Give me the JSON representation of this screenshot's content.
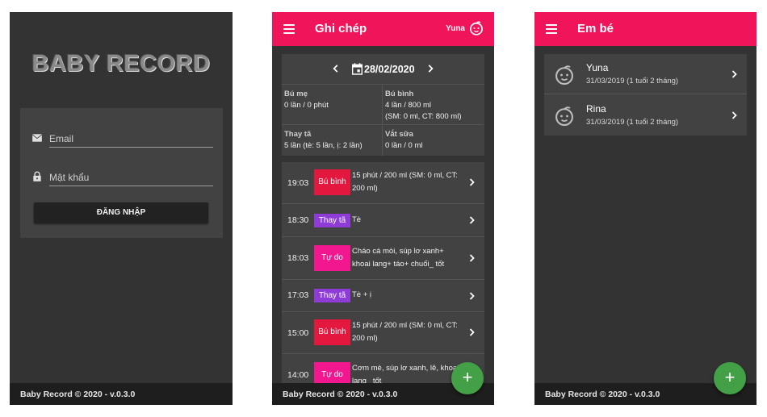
{
  "colors": {
    "accent": "#f0145a",
    "background": "#333333",
    "card": "#424242",
    "fab": "#43a047",
    "badge_feed": "#e4173f",
    "badge_diaper": "#8e3bd8",
    "badge_free": "#f2168f"
  },
  "login": {
    "logo": "BABY RECORD",
    "email_placeholder": "Email",
    "password_placeholder": "Mật khẩu",
    "login_button": "ĐĂNG NHẬP",
    "email_icon": "mail-icon",
    "password_icon": "lock-icon"
  },
  "journal": {
    "title": "Ghi chép",
    "user": "Yuna",
    "date": "28/02/2020",
    "summary": [
      {
        "label": "Bú mẹ",
        "lines": [
          "0 lần / 0 phút"
        ]
      },
      {
        "label": "Bú bình",
        "lines": [
          "4 lần / 800 ml",
          "(SM: 0 ml, CT: 800 ml)"
        ]
      },
      {
        "label": "Thay tã",
        "lines": [
          "5 lần (tè: 5 lần, ị: 2 lần)"
        ]
      },
      {
        "label": "Vắt sữa",
        "lines": [
          "0 lần / 0 ml"
        ]
      }
    ],
    "entries": [
      {
        "time": "19:03",
        "type": "Bú bình",
        "kind": "feed",
        "text": "15 phút / 200 ml (SM: 0 ml, CT: 200 ml)"
      },
      {
        "time": "18:30",
        "type": "Thay tã",
        "kind": "diaper",
        "text": "Tè"
      },
      {
        "time": "18:03",
        "type": "Tự do",
        "kind": "free",
        "text": "Cháo cá mòi, súp lơ xanh+ khoai lang+ táo+ chuối_ tốt"
      },
      {
        "time": "17:03",
        "type": "Thay tã",
        "kind": "diaper",
        "text": "Tè + ị"
      },
      {
        "time": "15:00",
        "type": "Bú bình",
        "kind": "feed",
        "text": "15 phút / 200 ml (SM: 0 ml, CT: 200 ml)"
      },
      {
        "time": "14:00",
        "type": "Tự do",
        "kind": "free",
        "text": "Cơm mè, súp lơ xanh, lê, khoai lang_ tốt"
      }
    ]
  },
  "babies": {
    "title": "Em bé",
    "list": [
      {
        "name": "Yuna",
        "dob": "31/03/2019 (1 tuổi 2 tháng)"
      },
      {
        "name": "Rina",
        "dob": "31/03/2019 (1 tuổi 2 tháng)"
      }
    ]
  },
  "footer": "Baby Record © 2020 - v.0.3.0",
  "fab_label": "+"
}
